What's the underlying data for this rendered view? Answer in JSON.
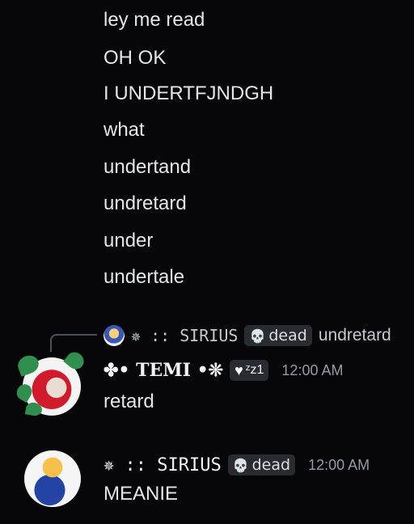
{
  "earlier_messages": [
    "ley me read",
    "OH OK",
    "I UNDERTFJNDGH",
    "what",
    "undertand",
    "undretard",
    "under",
    "undertale"
  ],
  "reply": {
    "author_name": "✵ :: SIRIUS",
    "tag_icon": "skull-icon",
    "tag_label": "dead",
    "content": "undretard"
  },
  "message_temi": {
    "author_name": "✤• TEMI •❊",
    "tag_icon": "heart-icon",
    "tag_label": "ᶻz1",
    "timestamp": "12:00 AM",
    "text": "retard"
  },
  "message_sirius": {
    "author_name": "✵ :: SIRIUS",
    "tag_icon": "skull-icon",
    "tag_label": "dead",
    "timestamp": "12:00 AM",
    "text": "MEANIE"
  }
}
